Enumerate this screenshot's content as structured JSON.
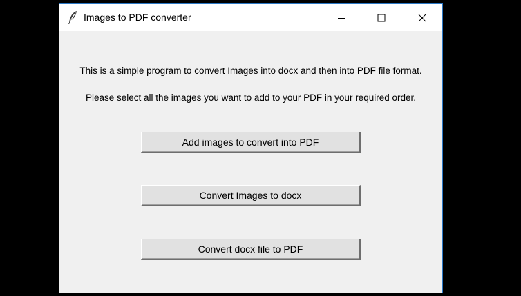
{
  "window": {
    "title": "Images to PDF converter",
    "app_icon": "feather-icon",
    "controls": {
      "minimize": "minimize-icon",
      "maximize": "maximize-icon",
      "close": "close-icon"
    }
  },
  "content": {
    "line1": "This is a simple program to convert Images into docx and then into PDF file format.",
    "line2": "Please select all the images you want to add to your PDF in your required order."
  },
  "buttons": {
    "add_images": "Add images to convert into PDF",
    "convert_to_docx": "Convert Images to docx",
    "convert_to_pdf": "Convert docx file to PDF"
  },
  "colors": {
    "window_bg": "#f0f0f0",
    "titlebar_bg": "#ffffff",
    "button_bg": "#e1e1e1",
    "accent_border": "#2b78c5"
  }
}
